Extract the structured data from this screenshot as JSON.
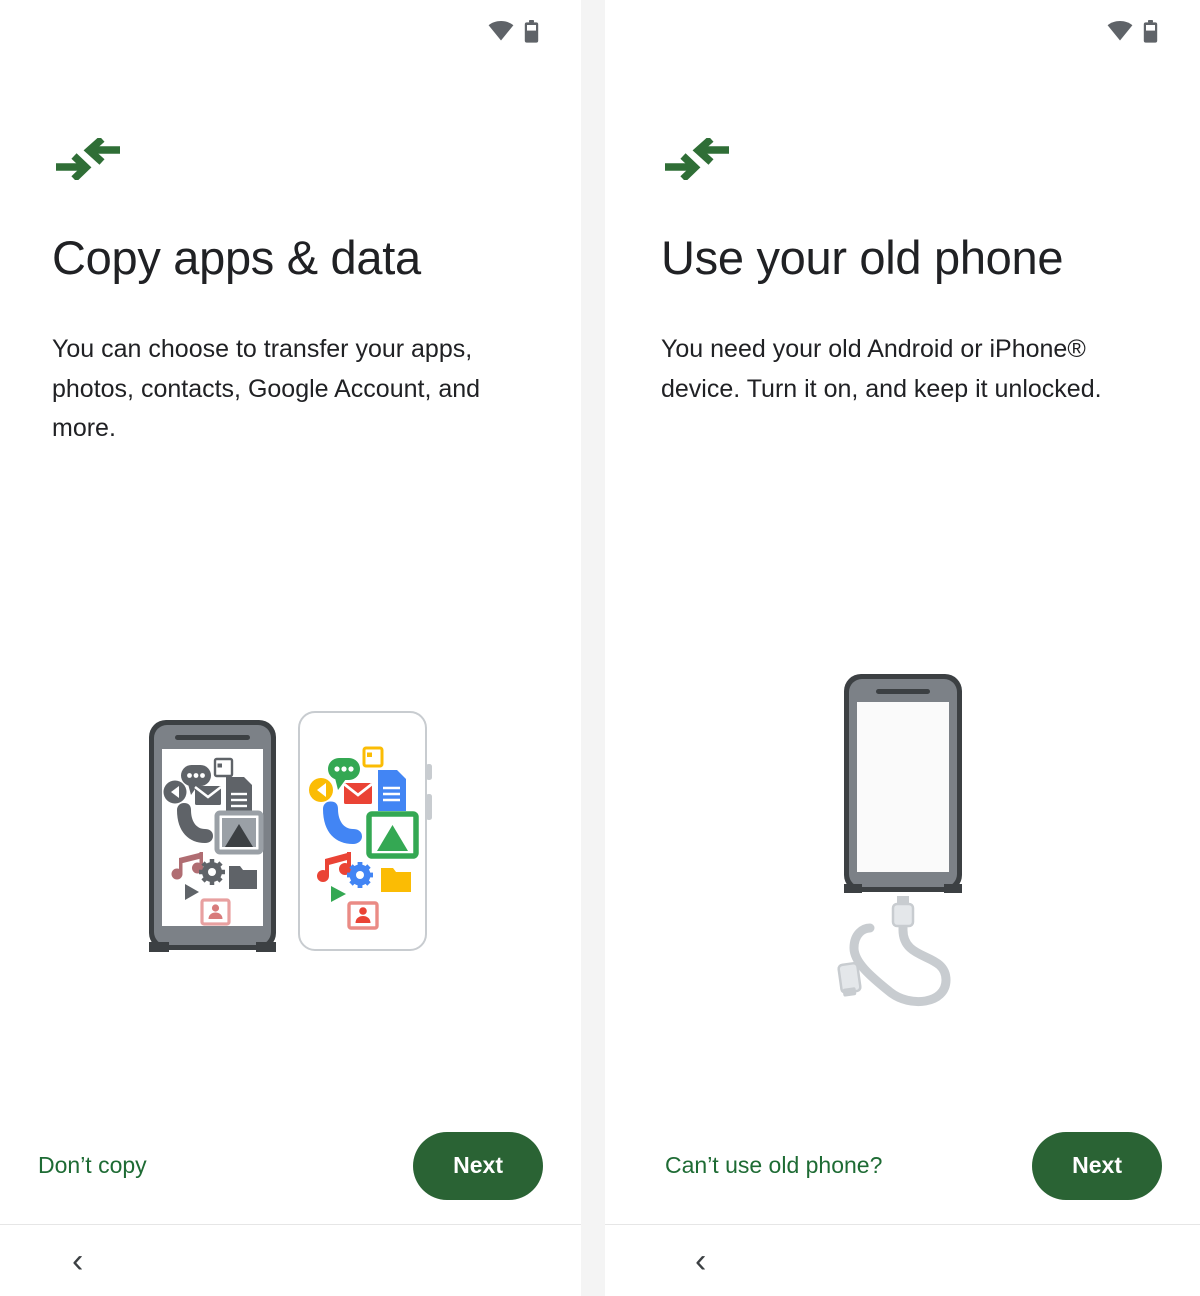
{
  "status_bar": {
    "wifi_icon": "wifi-icon",
    "battery_icon": "battery-icon"
  },
  "colors": {
    "brand_green": "#2a6334",
    "link_green": "#1e6b34",
    "title_text": "#202124",
    "body_text": "#202124",
    "panel_background": "#ffffff",
    "gap_background": "#f4f4f4",
    "icon_grey": "#5f6368",
    "phone_frame_dark": "#3c4043",
    "phone_body_grey": "#7c8187",
    "cable_grey": "#c8ccd0",
    "google_blue": "#4285f4",
    "google_red": "#ea4335",
    "google_yellow": "#fbbc04",
    "google_green": "#34a853"
  },
  "screens": [
    {
      "id": "copy-apps-and-data",
      "brand_icon": "transfer-arrows-icon",
      "title": "Copy apps & data",
      "body": "You can choose to transfer your apps, photos, contacts, Google Account, and more.",
      "illustration": "two-phones-transferring-apps-illustration",
      "footer": {
        "secondary_label": "Don’t copy",
        "primary_label": "Next"
      },
      "nav_back_icon": "back-chevron-icon",
      "nav_back_glyph": "‹"
    },
    {
      "id": "use-your-old-phone",
      "brand_icon": "transfer-arrows-icon",
      "title": "Use your old phone",
      "body": "You need your old Android or iPhone® device. Turn it on, and keep it unlocked.",
      "illustration": "phone-with-usb-cable-illustration",
      "footer": {
        "secondary_label": "Can’t use old phone?",
        "primary_label": "Next"
      },
      "nav_back_icon": "back-chevron-icon",
      "nav_back_glyph": "‹"
    }
  ],
  "illustration_apps": {
    "left_phone_tint": "grey",
    "right_phone_tint": "color",
    "app_icons": [
      "calendar-icon",
      "chat-bubble-icon",
      "play-back-icon",
      "mail-icon",
      "document-icon",
      "phone-call-icon",
      "photos-icon",
      "music-note-icon",
      "settings-gear-icon",
      "folder-icon",
      "play-triangle-icon",
      "contact-card-icon"
    ]
  }
}
